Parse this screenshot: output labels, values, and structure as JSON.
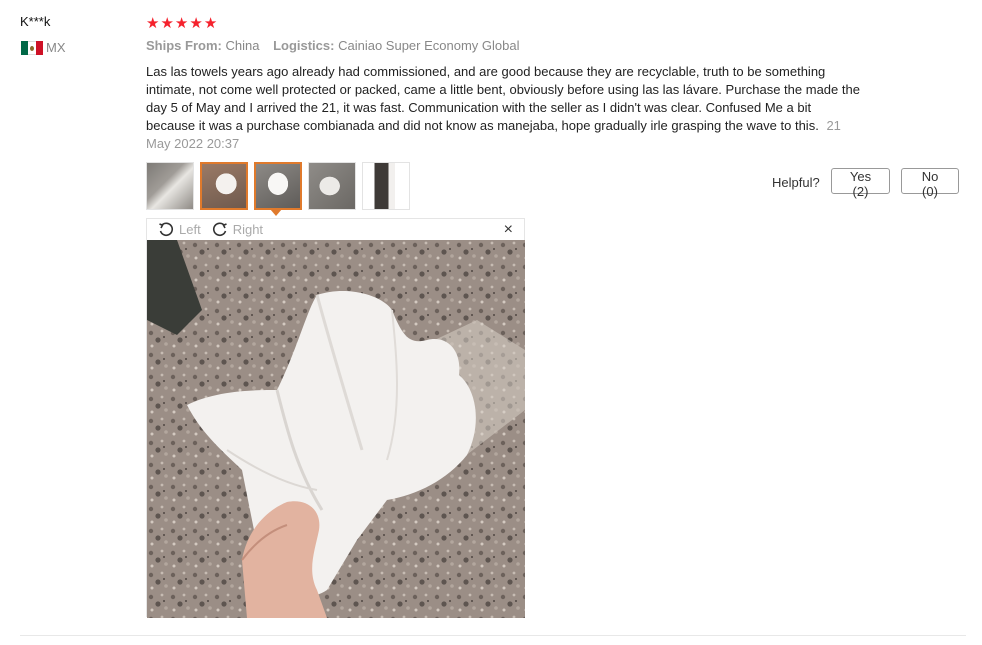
{
  "review": {
    "user": "K***k",
    "country_code": "MX",
    "flag_colors": [
      "#006847",
      "#ffffff",
      "#ce1126"
    ],
    "rating": 5,
    "star_glyph": "★",
    "star_color": "#f5222d",
    "ships_from_label": "Ships From:",
    "ships_from_value": "China",
    "logistics_label": "Logistics:",
    "logistics_value": "Cainiao Super Economy Global",
    "text": "Las las towels years ago already had commissioned, and are good because they are recyclable, truth to be something intimate, not come well protected or packed, came a little bent, obviously before using las las lávare. Purchase the made the day 5 of May and I arrived the 21, it was fast. Communication with the seller as I didn't was clear. Confused Me a bit because it was a purchase combianada and did not know as manejaba, hope gradually irle grasping the wave to this.",
    "date": "21 May 2022 20:37"
  },
  "thumbnails": {
    "count": 5,
    "selected_index": 2,
    "accent": "#e07a2c"
  },
  "helpful": {
    "label": "Helpful?",
    "yes_label": "Yes (2)",
    "no_label": "No (0)"
  },
  "viewer": {
    "rotate_left_label": "Left",
    "rotate_right_label": "Right",
    "close_glyph": "×"
  }
}
